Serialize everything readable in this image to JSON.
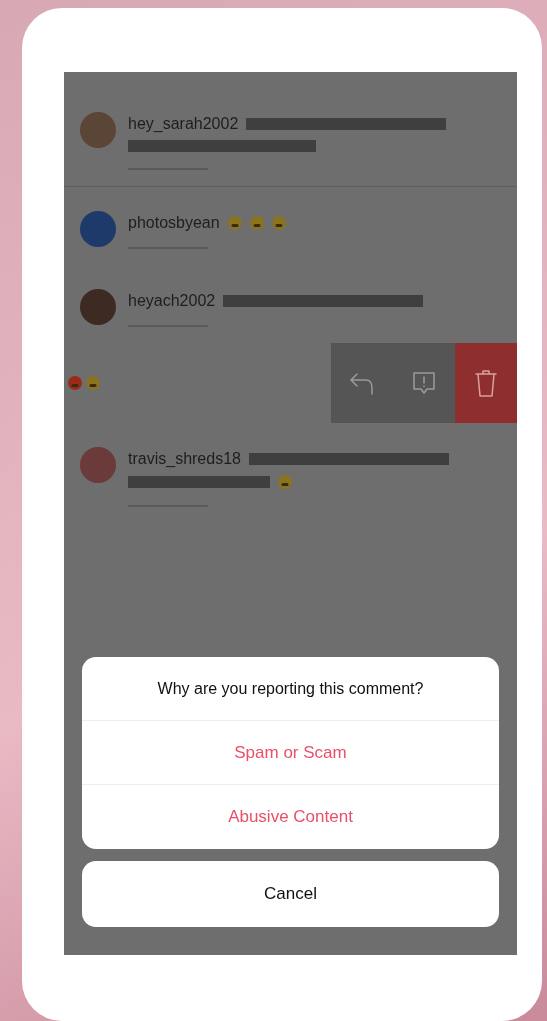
{
  "comments": [
    {
      "username": "hey_sarah2002",
      "kind": "two-lines",
      "divider": true
    },
    {
      "username": "photosbyean",
      "kind": "emoji",
      "divider": false
    },
    {
      "username": "heyach2002",
      "kind": "one-line",
      "divider": false
    },
    {
      "kind": "swiped",
      "actions": [
        {
          "kind": "reply"
        },
        {
          "kind": "report"
        },
        {
          "kind": "delete"
        }
      ]
    },
    {
      "username": "travis_shreds18",
      "kind": "two-lines-emoji",
      "divider": false
    }
  ],
  "sheet": {
    "title": "Why are you reporting this comment?",
    "options": [
      "Spam or Scam",
      "Abusive Content"
    ],
    "cancel": "Cancel"
  }
}
